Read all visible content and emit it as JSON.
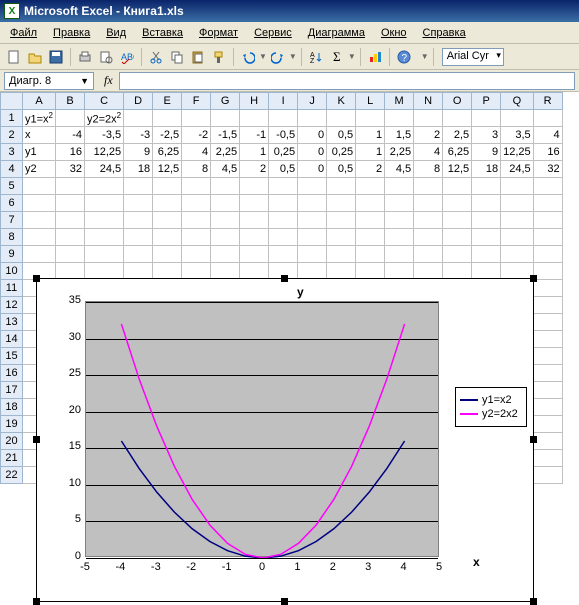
{
  "window": {
    "title": "Microsoft Excel - Книга1.xls",
    "app_icon": "X"
  },
  "menu": [
    "Файл",
    "Правка",
    "Вид",
    "Вставка",
    "Формат",
    "Сервис",
    "Диаграмма",
    "Окно",
    "Справка"
  ],
  "toolbar": {
    "font": "Arial Cyr"
  },
  "namebox": "Диагр. 8",
  "fx_label": "fx",
  "columns": [
    "A",
    "B",
    "C",
    "D",
    "E",
    "F",
    "G",
    "H",
    "I",
    "J",
    "K",
    "L",
    "M",
    "N",
    "O",
    "P",
    "Q",
    "R"
  ],
  "rows_visible": 22,
  "cells": {
    "A1": "y1=x²",
    "C1": "y2=2x²",
    "A2": "x",
    "B2": "-4",
    "C2": "-3,5",
    "D2": "-3",
    "E2": "-2,5",
    "F2": "-2",
    "G2": "-1,5",
    "H2": "-1",
    "I2": "-0,5",
    "J2": "0",
    "K2": "0,5",
    "L2": "1",
    "M2": "1,5",
    "N2": "2",
    "O2": "2,5",
    "P2": "3",
    "Q2": "3,5",
    "R2": "4",
    "A3": "y1",
    "B3": "16",
    "C3": "12,25",
    "D3": "9",
    "E3": "6,25",
    "F3": "4",
    "G3": "2,25",
    "H3": "1",
    "I3": "0,25",
    "J3": "0",
    "K3": "0,25",
    "L3": "1",
    "M3": "2,25",
    "N3": "4",
    "O3": "6,25",
    "P3": "9",
    "Q3": "12,25",
    "R3": "16",
    "A4": "y2",
    "B4": "32",
    "C4": "24,5",
    "D4": "18",
    "E4": "12,5",
    "F4": "8",
    "G4": "4,5",
    "H4": "2",
    "I4": "0,5",
    "J4": "0",
    "K4": "0,5",
    "L4": "2",
    "M4": "4,5",
    "N4": "8",
    "O4": "12,5",
    "P4": "18",
    "Q4": "24,5",
    "R4": "32"
  },
  "chart_data": {
    "type": "line",
    "title": "",
    "xlabel": "x",
    "ylabel": "y",
    "xlim": [
      -5,
      5
    ],
    "ylim": [
      0,
      35
    ],
    "xticks": [
      -5,
      -4,
      -3,
      -2,
      -1,
      0,
      1,
      2,
      3,
      4,
      5
    ],
    "yticks": [
      0,
      5,
      10,
      15,
      20,
      25,
      30,
      35
    ],
    "x": [
      -4,
      -3.5,
      -3,
      -2.5,
      -2,
      -1.5,
      -1,
      -0.5,
      0,
      0.5,
      1,
      1.5,
      2,
      2.5,
      3,
      3.5,
      4
    ],
    "series": [
      {
        "name": "y1=x2",
        "color": "#000080",
        "values": [
          16,
          12.25,
          9,
          6.25,
          4,
          2.25,
          1,
          0.25,
          0,
          0.25,
          1,
          2.25,
          4,
          6.25,
          9,
          12.25,
          16
        ]
      },
      {
        "name": "y2=2x2",
        "color": "#ff00ff",
        "values": [
          32,
          24.5,
          18,
          12.5,
          8,
          4.5,
          2,
          0.5,
          0,
          0.5,
          2,
          4.5,
          8,
          12.5,
          18,
          24.5,
          32
        ]
      }
    ],
    "legend_position": "right",
    "grid": "horizontal"
  },
  "icons": {
    "new": "□",
    "open": "📂",
    "save": "💾",
    "print": "",
    "preview": "",
    "spell": "",
    "cut": "✂",
    "copy": "",
    "paste": "",
    "fmt": "",
    "undo": "↶",
    "redo": "↷",
    "sort": "",
    "sum": "Σ",
    "chart": "",
    "help": "?"
  }
}
